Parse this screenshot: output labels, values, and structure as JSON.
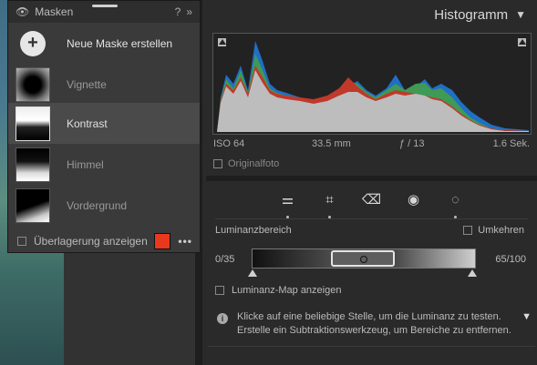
{
  "masks_panel": {
    "title": "Masken",
    "help_icon": "?",
    "collapse_icon": "»",
    "new_mask_label": "Neue Maske erstellen",
    "items": [
      {
        "label": "Vignette",
        "selected": false
      },
      {
        "label": "Kontrast",
        "selected": true
      },
      {
        "label": "Himmel",
        "selected": false
      },
      {
        "label": "Vordergrund",
        "selected": false
      }
    ],
    "overlay_label": "Überlagerung anzeigen",
    "overlay_color": "#e8391e",
    "more_label": "•••"
  },
  "histogram": {
    "title": "Histogramm",
    "iso": "ISO 64",
    "focal": "33.5 mm",
    "aperture": "ƒ / 13",
    "shutter": "1.6 Sek.",
    "original_label": "Originalfoto"
  },
  "tools": [
    "sliders-icon",
    "crop-icon",
    "eraser-icon",
    "redeye-icon",
    "mask-icon"
  ],
  "luminance": {
    "label": "Luminanzbereich",
    "invert_label": "Umkehren",
    "range_low": "0/35",
    "range_high": "65/100",
    "map_label": "Luminanz-Map anzeigen",
    "info_text": "Klicke auf eine beliebige Stelle, um die Luminanz zu testen. Erstelle ein Subtraktionswerkzeug, um Bereiche zu entfernen."
  }
}
